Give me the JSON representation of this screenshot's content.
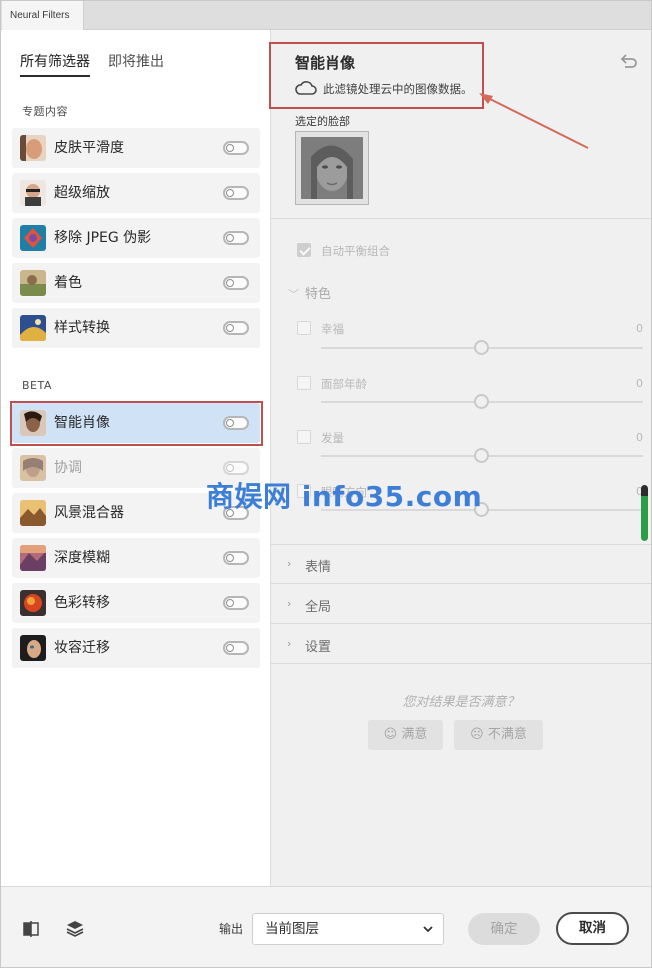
{
  "window": {
    "tab_title": "Neural Filters"
  },
  "left_panel": {
    "segments": [
      {
        "label": "所有筛选器",
        "active": true
      },
      {
        "label": "即将推出",
        "active": false
      }
    ],
    "featured_section": "专题内容",
    "featured_filters": [
      {
        "label": "皮肤平滑度",
        "icon": "skin-smoothing-thumbnail",
        "enabled": false
      },
      {
        "label": "超级缩放",
        "icon": "super-zoom-thumbnail",
        "enabled": false
      },
      {
        "label": "移除 JPEG 伪影",
        "icon": "jpeg-artifacts-thumbnail",
        "enabled": false
      },
      {
        "label": "着色",
        "icon": "colorize-thumbnail",
        "enabled": false
      },
      {
        "label": "样式转换",
        "icon": "style-transfer-thumbnail",
        "enabled": false
      }
    ],
    "beta_section": "BETA",
    "beta_filters": [
      {
        "label": "智能肖像",
        "icon": "smart-portrait-thumbnail",
        "enabled": false,
        "selected": true
      },
      {
        "label": "协调",
        "icon": "harmonization-thumbnail",
        "enabled": false,
        "disabled": true
      },
      {
        "label": "风景混合器",
        "icon": "landscape-mixer-thumbnail",
        "enabled": false
      },
      {
        "label": "深度模糊",
        "icon": "depth-blur-thumbnail",
        "enabled": false
      },
      {
        "label": "色彩转移",
        "icon": "color-transfer-thumbnail",
        "enabled": false
      },
      {
        "label": "妆容迁移",
        "icon": "makeup-transfer-thumbnail",
        "enabled": false
      }
    ]
  },
  "right_panel": {
    "title": "智能肖像",
    "cloud_note": "此滤镜处理云中的图像数据。",
    "selected_faces_label": "选定的脸部",
    "auto_balance_label": "自动平衡组合",
    "auto_balance_checked": true,
    "featured_group": {
      "label": "特色",
      "sliders": [
        {
          "label": "幸福",
          "value": "0",
          "fraction": 0.5
        },
        {
          "label": "面部年龄",
          "value": "0",
          "fraction": 0.5
        },
        {
          "label": "发量",
          "value": "0",
          "fraction": 0.5
        },
        {
          "label": "眼睛方向",
          "value": "0",
          "fraction": 0.5
        }
      ]
    },
    "collapsed_groups": [
      "表情",
      "全局",
      "设置"
    ],
    "feedback": {
      "question": "您对结果是否满意？",
      "yes_label": "满意",
      "no_label": "不满意"
    }
  },
  "bottom_bar": {
    "output_label": "输出",
    "output_value": "当前图层",
    "ok_label": "确定",
    "cancel_label": "取消"
  },
  "watermark": "商娱网 info35.com",
  "colors": {
    "selected_bg": "#cfe2f6",
    "highlight_red": "#c0504d",
    "watermark_blue": "#3d7fd6",
    "scroll_green": "#2e9d48"
  }
}
